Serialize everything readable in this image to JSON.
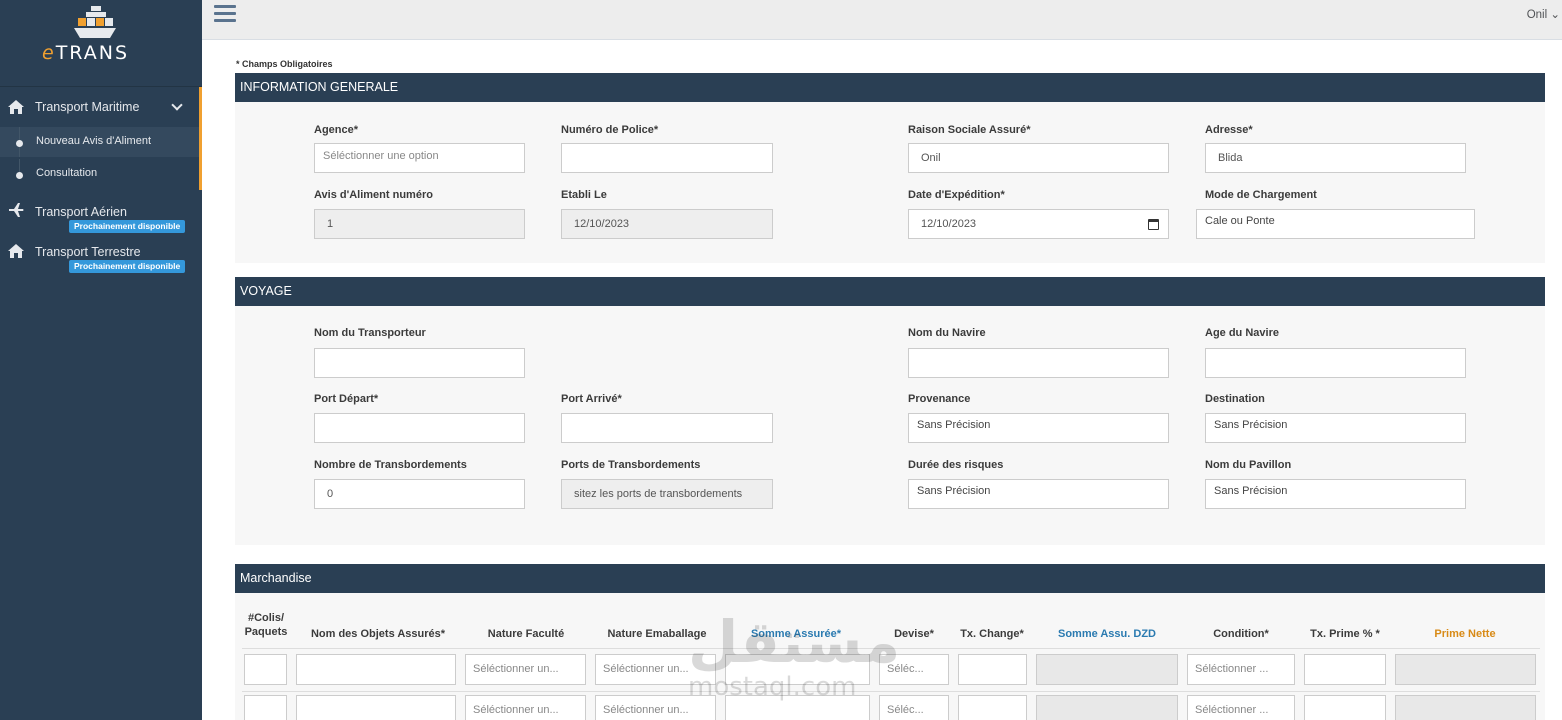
{
  "brand": {
    "logo_text": "TRANS",
    "logo_e": "e",
    "icon": "ship-icon"
  },
  "sidebar": {
    "transport_maritime": {
      "label": "Transport Maritime",
      "icon": "home-icon"
    },
    "sub_items": [
      {
        "label": "Nouveau Avis d'Aliment"
      },
      {
        "label": "Consultation"
      }
    ],
    "transport_aerien": {
      "label": "Transport Aérien",
      "badge": "Prochainement disponible",
      "icon": "plane-icon"
    },
    "transport_terrestre": {
      "label": "Transport Terrestre",
      "badge": "Prochainement disponible",
      "icon": "home-icon"
    }
  },
  "topbar": {
    "user": "Onil",
    "menu_icon": "hamburger-icon"
  },
  "form": {
    "required_note": "* Champs Obligatoires",
    "info": {
      "title": "INFORMATION GENERALE",
      "agence_label": "Agence*",
      "agence_placeholder": "Séléctionner une option",
      "police_label": "Numéro de Police*",
      "police_value": "",
      "raison_label": "Raison Sociale Assuré*",
      "raison_value": "Onil",
      "adresse_label": "Adresse*",
      "adresse_value": "Blida",
      "avis_label": "Avis d'Aliment numéro",
      "avis_value": "1",
      "etabli_label": "Etabli Le",
      "etabli_value": "12/10/2023",
      "expedition_label": "Date d'Expédition*",
      "expedition_value": "12/10/2023",
      "chargement_label": "Mode de Chargement",
      "chargement_value": "Cale ou Ponte"
    },
    "voyage": {
      "title": "VOYAGE",
      "transporteur_label": "Nom du Transporteur",
      "navire_label": "Nom du Navire",
      "age_label": "Age du Navire",
      "depart_label": "Port Départ*",
      "arrive_label": "Port Arrivé*",
      "provenance_label": "Provenance",
      "provenance_value": "Sans Précision",
      "destination_label": "Destination",
      "destination_value": "Sans Précision",
      "transbordements_label": "Nombre de Transbordements",
      "transbordements_value": "0",
      "ports_trans_label": "Ports de Transbordements",
      "ports_trans_placeholder": "sitez les ports de transbordements",
      "duree_label": "Durée des risques",
      "duree_value": "Sans Précision",
      "pavillon_label": "Nom du Pavillon",
      "pavillon_value": "Sans Précision"
    },
    "marchandise": {
      "title": "Marchandise",
      "headers": {
        "colis_1": "#Colis/",
        "colis_2": "Paquets",
        "objets": "Nom des Objets Assurés*",
        "faculte": "Nature Faculté",
        "emballage": "Nature Emaballage",
        "somme": "Somme Assurée*",
        "devise": "Devise*",
        "change": "Tx. Change*",
        "somme_dzd": "Somme Assu. DZD",
        "condition": "Condition*",
        "prime_pct": "Tx. Prime % *",
        "prime_nette": "Prime Nette"
      },
      "select_short": "Séléctionner un...",
      "select_devise": "Séléc...",
      "select_condition": "Séléctionner ..."
    }
  },
  "watermark": {
    "arabic": "مستقل",
    "latin": "mostaql.com"
  }
}
